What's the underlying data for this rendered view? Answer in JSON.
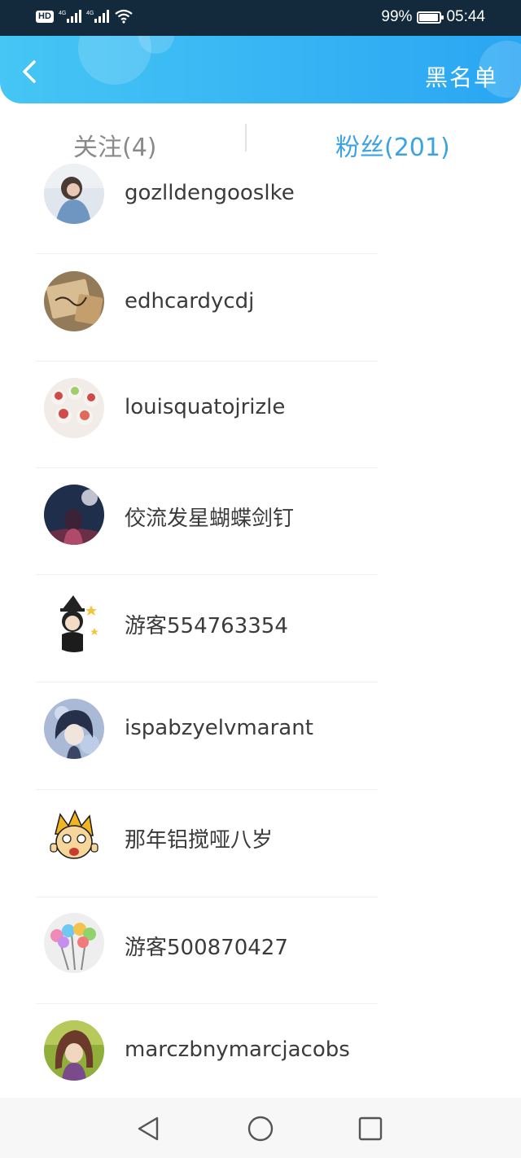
{
  "status_bar": {
    "hd_label": "HD",
    "network_left": "4G",
    "network_right": "4G",
    "battery": "99%",
    "time": "05:44"
  },
  "header": {
    "back_icon": "chevron-left-icon",
    "blacklist_label": "黑名单"
  },
  "tabs": {
    "following_label": "关注(4)",
    "fans_label": "粉丝(201)",
    "active": "fans"
  },
  "fans": [
    {
      "name": "gozlldengooslke"
    },
    {
      "name": "edhcardycdj"
    },
    {
      "name": "louisquatojrizle"
    },
    {
      "name": "佼流发星蝴蝶剑钉"
    },
    {
      "name": "游客554763354"
    },
    {
      "name": "ispabzyelvmarant"
    },
    {
      "name": "那年铝搅哑八岁"
    },
    {
      "name": "游客500870427"
    },
    {
      "name": "marczbnymarcjacobs"
    }
  ],
  "nav_bar": {
    "back_icon": "triangle-back-icon",
    "home_icon": "circle-home-icon",
    "recent_icon": "square-recent-icon"
  },
  "colors": {
    "header_start": "#45c6f4",
    "header_end": "#2aa6f3",
    "active_tab": "#3ba3e3",
    "inactive_tab": "#8a8a8a"
  }
}
